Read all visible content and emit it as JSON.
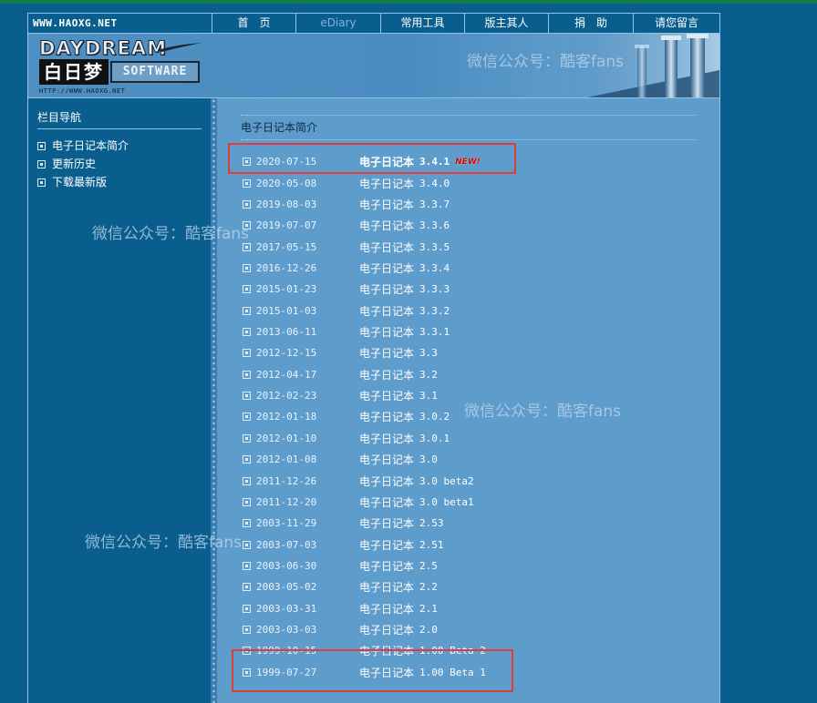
{
  "site_url": "WWW.HAOXG.NET",
  "nav": [
    {
      "label": "首　页",
      "active": false
    },
    {
      "label": "eDiary",
      "active": true
    },
    {
      "label": "常用工具",
      "active": false
    },
    {
      "label": "版主其人",
      "active": false
    },
    {
      "label": "捐　助",
      "active": false
    },
    {
      "label": "请您留言",
      "active": false
    }
  ],
  "logo": {
    "title": "DAYDREAM",
    "chinese": "白日梦",
    "software": "SOFTWARE",
    "url": "HTTP://WWW.HAOXG.NET"
  },
  "sidebar": {
    "title": "栏目导航",
    "links": [
      "电子日记本简介",
      "更新历史",
      "下载最新版"
    ]
  },
  "main": {
    "title": "电子日记本简介",
    "new_badge": "NEW!",
    "versions": [
      {
        "date": "2020-07-15",
        "name": "电子日记本",
        "version": "3.4.1",
        "new": true
      },
      {
        "date": "2020-05-08",
        "name": "电子日记本",
        "version": "3.4.0"
      },
      {
        "date": "2019-08-03",
        "name": "电子日记本",
        "version": "3.3.7"
      },
      {
        "date": "2019-07-07",
        "name": "电子日记本",
        "version": "3.3.6"
      },
      {
        "date": "2017-05-15",
        "name": "电子日记本",
        "version": "3.3.5"
      },
      {
        "date": "2016-12-26",
        "name": "电子日记本",
        "version": "3.3.4"
      },
      {
        "date": "2015-01-23",
        "name": "电子日记本",
        "version": "3.3.3"
      },
      {
        "date": "2015-01-03",
        "name": "电子日记本",
        "version": "3.3.2"
      },
      {
        "date": "2013-06-11",
        "name": "电子日记本",
        "version": "3.3.1"
      },
      {
        "date": "2012-12-15",
        "name": "电子日记本",
        "version": "3.3"
      },
      {
        "date": "2012-04-17",
        "name": "电子日记本",
        "version": "3.2"
      },
      {
        "date": "2012-02-23",
        "name": "电子日记本",
        "version": "3.1"
      },
      {
        "date": "2012-01-18",
        "name": "电子日记本",
        "version": "3.0.2"
      },
      {
        "date": "2012-01-10",
        "name": "电子日记本",
        "version": "3.0.1"
      },
      {
        "date": "2012-01-08",
        "name": "电子日记本",
        "version": "3.0"
      },
      {
        "date": "2011-12-26",
        "name": "电子日记本",
        "version": "3.0 beta2"
      },
      {
        "date": "2011-12-20",
        "name": "电子日记本",
        "version": "3.0 beta1"
      },
      {
        "date": "2003-11-29",
        "name": "电子日记本",
        "version": "2.53"
      },
      {
        "date": "2003-07-03",
        "name": "电子日记本",
        "version": "2.51"
      },
      {
        "date": "2003-06-30",
        "name": "电子日记本",
        "version": "2.5"
      },
      {
        "date": "2003-05-02",
        "name": "电子日记本",
        "version": "2.2"
      },
      {
        "date": "2003-03-31",
        "name": "电子日记本",
        "version": "2.1"
      },
      {
        "date": "2003-03-03",
        "name": "电子日记本",
        "version": "2.0"
      },
      {
        "date": "1999-10-15",
        "name": "电子日记本",
        "version": "1.00 Beta 2"
      },
      {
        "date": "1999-07-27",
        "name": "电子日记本",
        "version": "1.00 Beta 1"
      }
    ]
  },
  "watermark": "微信公众号：酷客fans",
  "colors": {
    "background": "#0a5e8e",
    "content_panel": "#5e9ccc",
    "highlight_box": "#e33b3b",
    "new_badge": "#d40000"
  }
}
